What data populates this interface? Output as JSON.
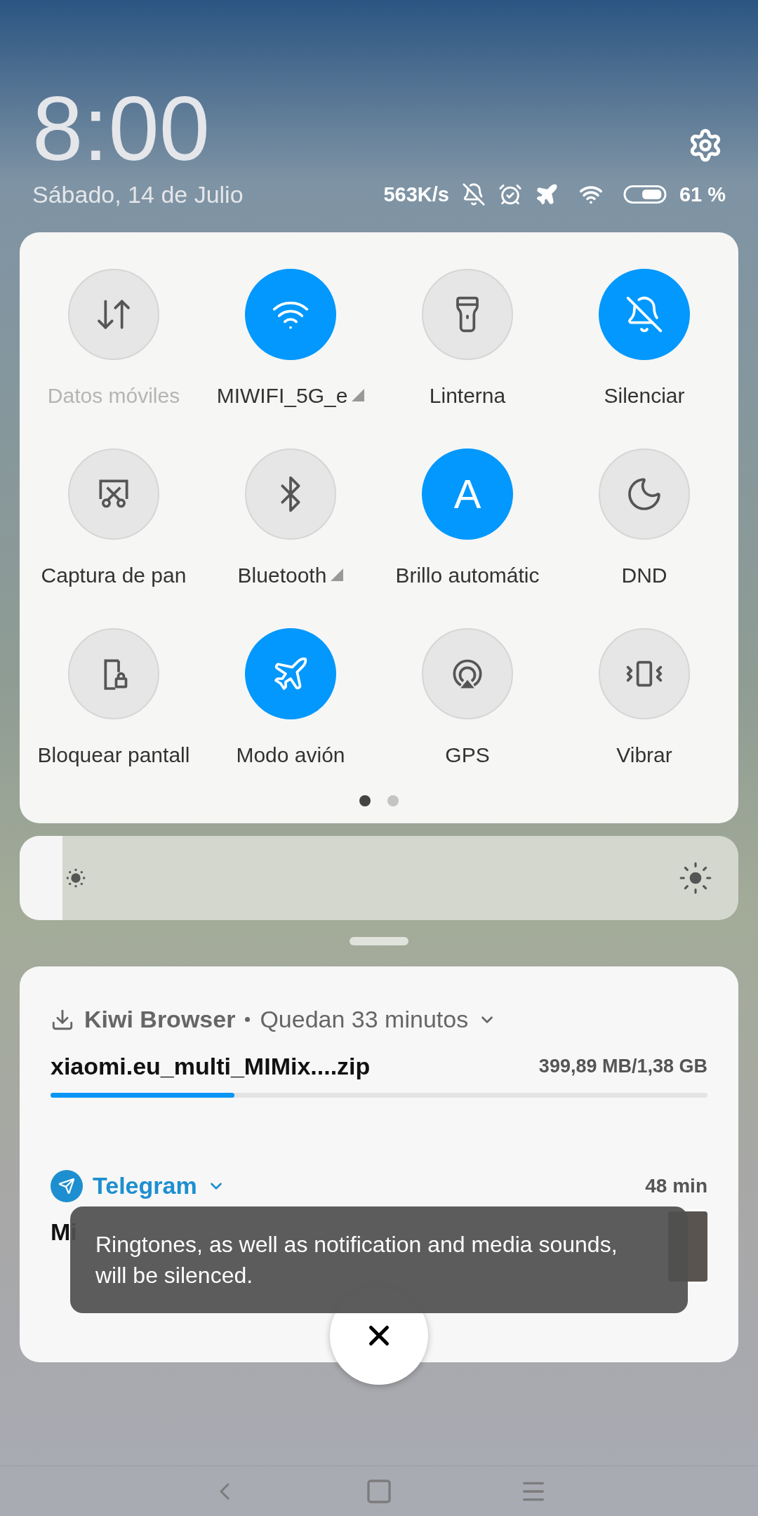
{
  "clock": {
    "time": "8:00",
    "date": "Sábado, 14 de Julio"
  },
  "status_bar": {
    "speed": "563K/s",
    "battery": "61 %"
  },
  "tiles": [
    {
      "label": "Datos móviles",
      "on": false,
      "disabled": true,
      "has_menu": false
    },
    {
      "label": "MIWIFI_5G_e",
      "on": true,
      "disabled": false,
      "has_menu": true
    },
    {
      "label": "Linterna",
      "on": false,
      "disabled": false,
      "has_menu": false
    },
    {
      "label": "Silenciar",
      "on": true,
      "disabled": false,
      "has_menu": false
    },
    {
      "label": "Captura de pan",
      "on": false,
      "disabled": false,
      "has_menu": false
    },
    {
      "label": "Bluetooth",
      "on": false,
      "disabled": false,
      "has_menu": true
    },
    {
      "label": "Brillo automátic",
      "on": true,
      "disabled": false,
      "has_menu": false,
      "glyph": "A"
    },
    {
      "label": "DND",
      "on": false,
      "disabled": false,
      "has_menu": false
    },
    {
      "label": "Bloquear pantall",
      "on": false,
      "disabled": false,
      "has_menu": false
    },
    {
      "label": "Modo avión",
      "on": true,
      "disabled": false,
      "has_menu": false
    },
    {
      "label": "GPS",
      "on": false,
      "disabled": false,
      "has_menu": false
    },
    {
      "label": "Vibrar",
      "on": false,
      "disabled": false,
      "has_menu": false
    }
  ],
  "pages": [
    {
      "selected": true
    },
    {
      "selected": false
    }
  ],
  "brightness": {
    "level": 0.06
  },
  "notifications": [
    {
      "kind": "download",
      "app": "Kiwi Browser",
      "info": "Quedan 33 minutos",
      "file": "xiaomi.eu_multi_MIMix....zip",
      "size": "399,89 MB/1,38 GB",
      "level": 0.28
    },
    {
      "kind": "message",
      "app": "Telegram",
      "time": "48 min",
      "title": "Mi"
    }
  ],
  "toast": {
    "text": "Ringtones, as well as notification and media sounds, will be silenced."
  }
}
